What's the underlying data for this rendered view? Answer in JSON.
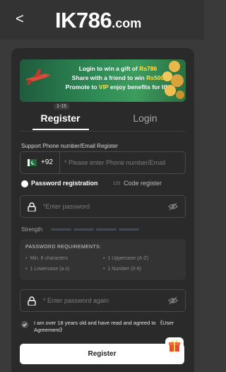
{
  "header": {
    "back_glyph": "<",
    "logo_main": "IK786",
    "logo_suffix": ".com"
  },
  "banner": {
    "line1_prefix": "Login to win a gift of ",
    "line1_highlight": "Rs786",
    "line2_prefix": "Share with a friend to win ",
    "line2_highlight": "Rs500",
    "line3_prefix": "Promote to ",
    "line3_highlight": "VIP",
    "line3_suffix": " enjoy benefits for life",
    "page_indicator": "1-15"
  },
  "tabs": {
    "register": "Register",
    "login": "Login"
  },
  "phone": {
    "label": "Support Phone number/Email Register",
    "country_code": "+92",
    "placeholder": "* Please enter Phone number/Email"
  },
  "mode": {
    "password_registration": "Password registration",
    "code_register": "Code register"
  },
  "password": {
    "placeholder": "*Enter password"
  },
  "strength": {
    "label": "Strength"
  },
  "requirements": {
    "title": "PASSWORD REQUIREMENTS:",
    "items": [
      "Min. 8 characters",
      "1 Uppercase (A-Z)",
      "1 Lowercase (a-z)",
      "1 Number (0-9)"
    ]
  },
  "confirm": {
    "placeholder": "* Enter password again"
  },
  "agreement": {
    "text": "I am over 18 years old and have read and agreed to 《User Agreement》"
  },
  "register_button": {
    "label": "Register"
  },
  "colors": {
    "page_bg": "#3a3a3a",
    "card_bg": "#2a2a2a",
    "banner_highlight": "#ffe14a",
    "button_bg": "#ffffff"
  },
  "icons": [
    "back-icon",
    "pakistan-flag-icon",
    "lock-icon",
    "eye-off-icon",
    "check-icon",
    "gift-icon"
  ]
}
